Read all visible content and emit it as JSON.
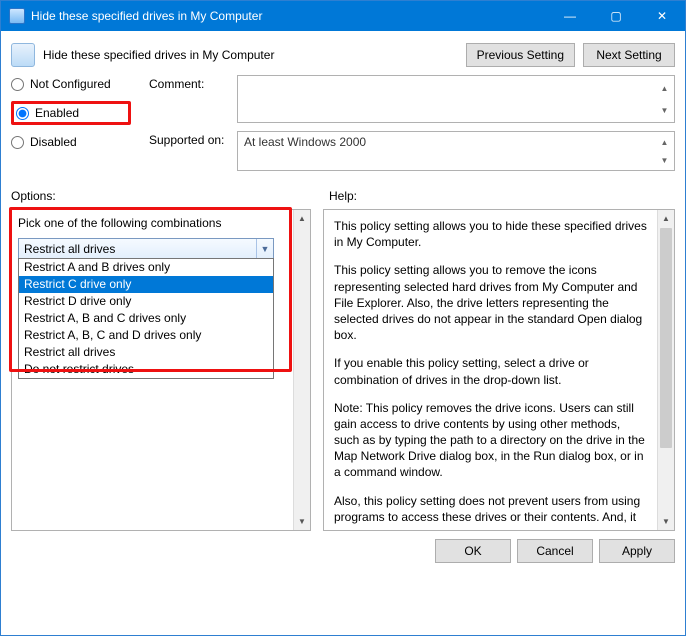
{
  "window": {
    "title": "Hide these specified drives in My Computer",
    "minimize": "—",
    "maximize": "▢",
    "close": "✕"
  },
  "header": {
    "policy_name": "Hide these specified drives in My Computer",
    "prev_btn": "Previous Setting",
    "next_btn": "Next Setting"
  },
  "state": {
    "not_configured": "Not Configured",
    "enabled": "Enabled",
    "disabled": "Disabled",
    "selected": "enabled"
  },
  "comment": {
    "label": "Comment:",
    "value": ""
  },
  "supported": {
    "label": "Supported on:",
    "value": "At least Windows 2000"
  },
  "sections": {
    "options": "Options:",
    "help": "Help:"
  },
  "options_pane": {
    "label": "Pick one of the following combinations",
    "combo_value": "Restrict all drives",
    "items": [
      "Restrict A and B drives only",
      "Restrict C drive only",
      "Restrict D drive only",
      "Restrict A, B and C drives only",
      "Restrict A, B, C and D drives only",
      "Restrict all drives",
      "Do not restrict drives"
    ],
    "highlighted_index": 1
  },
  "help_pane": {
    "paragraphs": [
      "This policy setting allows you to hide these specified drives in My Computer.",
      "This policy setting allows you to remove the icons representing selected hard drives from My Computer and File Explorer. Also, the drive letters representing the selected drives do not appear in the standard Open dialog box.",
      "If you enable this policy setting, select a drive or combination of drives in the drop-down list.",
      "Note: This policy removes the drive icons. Users can still gain access to drive contents by using other methods, such as by typing the path to a directory on the drive in the Map Network Drive dialog box, in the Run dialog box, or in a command window.",
      "Also, this policy setting does not prevent users from using programs to access these drives or their contents. And, it does not prevent users from using the Disk Management snap-in to view and change drive characteristics."
    ]
  },
  "buttons": {
    "ok": "OK",
    "cancel": "Cancel",
    "apply": "Apply"
  }
}
